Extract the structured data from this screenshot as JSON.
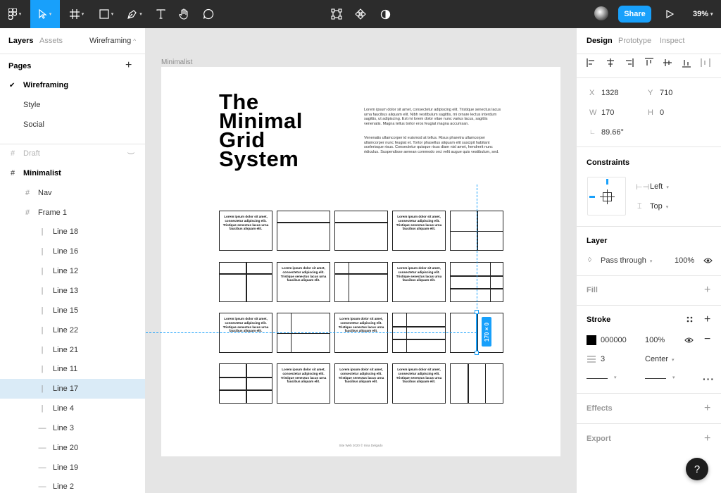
{
  "toolbar": {
    "zoom": "39%",
    "share_label": "Share",
    "tools": [
      "figma-menu-icon",
      "move-tool-icon",
      "frame-tool-icon",
      "shape-tool-icon",
      "pen-tool-icon",
      "text-tool-icon",
      "hand-tool-icon",
      "comment-tool-icon"
    ],
    "center_tools": [
      "crop-icon",
      "component-icon",
      "contrast-icon"
    ]
  },
  "left": {
    "tab_layers": "Layers",
    "tab_assets": "Assets",
    "page_select": "Wireframing",
    "pages_heading": "Pages",
    "pages": [
      {
        "label": "Wireframing",
        "current": true
      },
      {
        "label": "Style",
        "current": false
      },
      {
        "label": "Social",
        "current": false
      }
    ],
    "layers": [
      {
        "label": "Draft",
        "icon": "frame-icon",
        "indent": 0,
        "faded": true,
        "bold": false
      },
      {
        "label": "Minimalist",
        "icon": "frame-icon",
        "indent": 0,
        "faded": false,
        "bold": true
      },
      {
        "label": "Nav",
        "icon": "frame-icon",
        "indent": 1,
        "faded": false,
        "bold": false
      },
      {
        "label": "Frame 1",
        "icon": "frame-icon",
        "indent": 1,
        "faded": false,
        "bold": false
      },
      {
        "label": "Line 18",
        "icon": "vertical-line-icon",
        "indent": 2
      },
      {
        "label": "Line 16",
        "icon": "vertical-line-icon",
        "indent": 2
      },
      {
        "label": "Line 12",
        "icon": "vertical-line-icon",
        "indent": 2
      },
      {
        "label": "Line 13",
        "icon": "vertical-line-icon",
        "indent": 2
      },
      {
        "label": "Line 15",
        "icon": "vertical-line-icon",
        "indent": 2
      },
      {
        "label": "Line 22",
        "icon": "vertical-line-icon",
        "indent": 2
      },
      {
        "label": "Line 21",
        "icon": "vertical-line-icon",
        "indent": 2
      },
      {
        "label": "Line 11",
        "icon": "vertical-line-icon",
        "indent": 2
      },
      {
        "label": "Line 17",
        "icon": "vertical-line-icon",
        "indent": 2,
        "selected": true
      },
      {
        "label": "Line 4",
        "icon": "vertical-line-icon",
        "indent": 2
      },
      {
        "label": "Line 3",
        "icon": "horizontal-line-icon",
        "indent": 2
      },
      {
        "label": "Line 20",
        "icon": "horizontal-line-icon",
        "indent": 2
      },
      {
        "label": "Line 19",
        "icon": "horizontal-line-icon",
        "indent": 2
      },
      {
        "label": "Line 2",
        "icon": "horizontal-line-icon",
        "indent": 2
      }
    ]
  },
  "canvas": {
    "frame_label": "Minimalist",
    "title_lines": [
      "The",
      "Minimal",
      "Grid",
      "System"
    ],
    "paragraph1": "Lorem ipsum dolor sit amet, consectetur adipiscing elit. Tristique senectus lacus urna faucibus aliquam elit. Nibh vestibulum sagittis, mi ornare lectus interdum sagittis, ut adipiscing. Est mi lorem dolor vitae nunc varius lacus, sagittis venenatis. Magna tellus tortor eros feugiat magna accumsan.",
    "paragraph2": "Venenatis ullamcorper id euismod at tellus. Risus pharetra ullamcorper ullamcorper nunc feugiat et. Tortor phasellus aliquam elit suscipit habitant scelerisque risus. Consectetur quisque risus diam nisl amet, hendrerit nunc ridiculus. Suspendisse aenean commodo orci velit augue quis vestibulum, sed.",
    "box_text": "Lorem ipsum dolor sit amet, consectetur adipiscing elit. Tristique senectus lacus urna faucibus aliquam elit.",
    "footer": "Site Web 2020 © Irina Delgado",
    "dimension_badge": "170 × 0"
  },
  "right": {
    "tab_design": "Design",
    "tab_prototype": "Prototype",
    "tab_inspect": "Inspect",
    "x_label": "X",
    "x_value": "1328",
    "y_label": "Y",
    "y_value": "710",
    "w_label": "W",
    "w_value": "170",
    "h_label": "H",
    "h_value": "0",
    "rotation_value": "89.66°",
    "constraints_heading": "Constraints",
    "constraint_h": "Left",
    "constraint_v": "Top",
    "layer_heading": "Layer",
    "blend_mode": "Pass through",
    "layer_opacity": "100%",
    "fill_heading": "Fill",
    "stroke_heading": "Stroke",
    "stroke_color": "000000",
    "stroke_opacity": "100%",
    "stroke_weight": "3",
    "stroke_align": "Center",
    "effects_heading": "Effects",
    "export_heading": "Export"
  },
  "help_label": "?",
  "colors": {
    "accent": "#18a0fb",
    "toolbar": "#2c2c2c",
    "selection_row": "#daebf7"
  }
}
